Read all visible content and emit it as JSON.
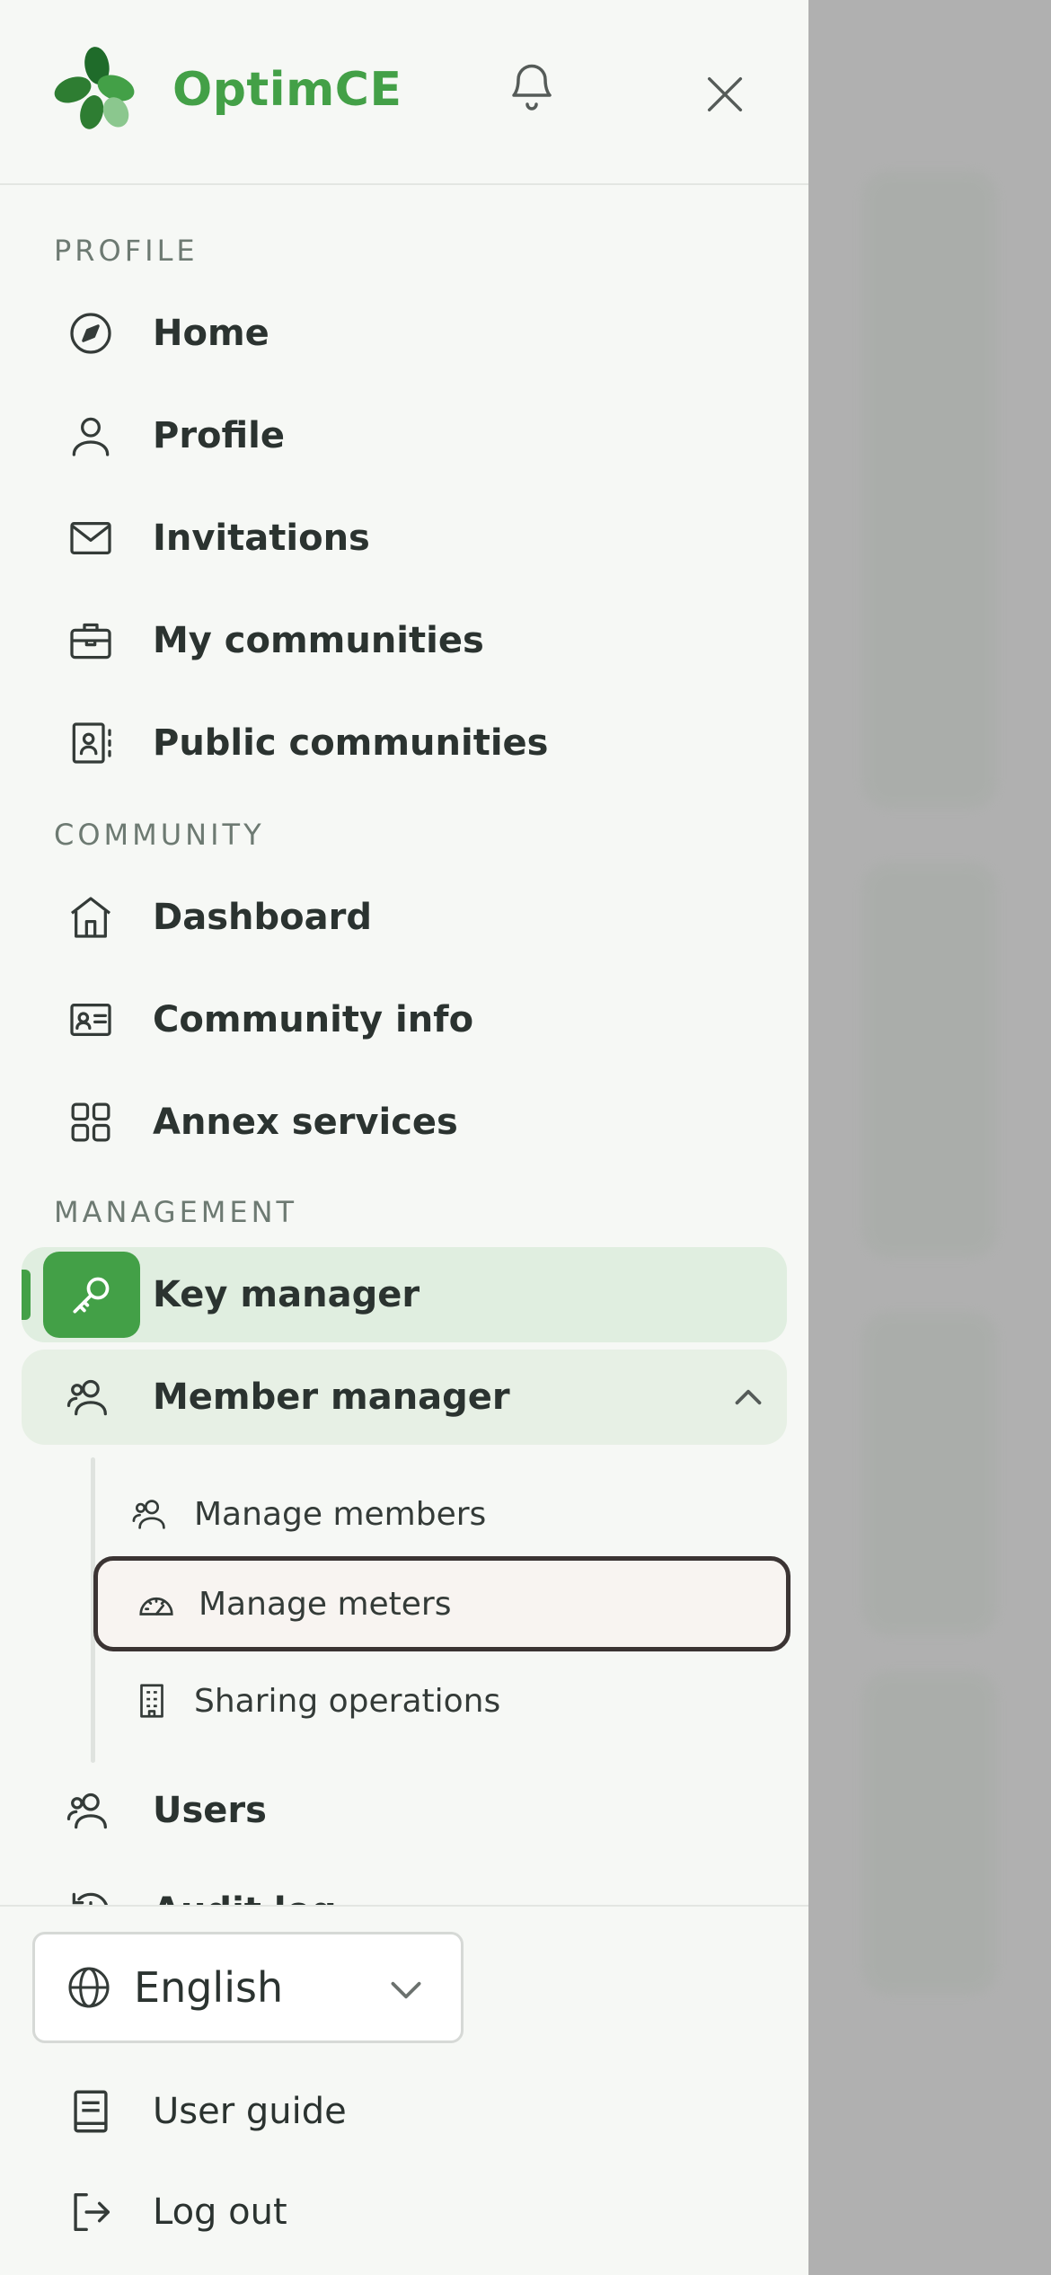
{
  "app": {
    "brand": "OptimCE"
  },
  "colors": {
    "brand": "#43a047",
    "active_bg": "#e0eee0",
    "focus_border": "#3b3433"
  },
  "header": {
    "logo_icon": "clover-logo-icon",
    "notifications_icon": "bell-icon",
    "close_icon": "close-icon"
  },
  "sections": {
    "profile": "PROFILE",
    "community": "COMMUNITY",
    "management": "MANAGEMENT"
  },
  "nav": {
    "home": {
      "label": "Home",
      "icon": "compass-icon"
    },
    "profile": {
      "label": "Profile",
      "icon": "user-icon"
    },
    "invitations": {
      "label": "Invitations",
      "icon": "mail-icon"
    },
    "my_communities": {
      "label": "My communities",
      "icon": "briefcase-icon"
    },
    "public_communities": {
      "label": "Public communities",
      "icon": "contact-book-icon"
    },
    "dashboard": {
      "label": "Dashboard",
      "icon": "home-icon"
    },
    "community_info": {
      "label": "Community info",
      "icon": "id-card-icon"
    },
    "annex_services": {
      "label": "Annex services",
      "icon": "grid-icon"
    },
    "key_manager": {
      "label": "Key manager",
      "icon": "key-icon",
      "active": true
    },
    "member_manager": {
      "label": "Member manager",
      "icon": "users-icon",
      "expanded": true
    },
    "users": {
      "label": "Users",
      "icon": "users-icon"
    },
    "audit": {
      "label": "Audit log",
      "icon": "history-icon"
    }
  },
  "member_manager_sub": {
    "manage_members": {
      "label": "Manage members",
      "icon": "users-icon"
    },
    "manage_meters": {
      "label": "Manage meters",
      "icon": "gauge-icon",
      "focused": true
    },
    "sharing_operations": {
      "label": "Sharing operations",
      "icon": "building-icon"
    }
  },
  "footer": {
    "language": {
      "value": "English",
      "icon": "globe-icon"
    },
    "user_guide": {
      "label": "User guide",
      "icon": "book-icon"
    },
    "logout": {
      "label": "Log out",
      "icon": "logout-icon"
    }
  }
}
